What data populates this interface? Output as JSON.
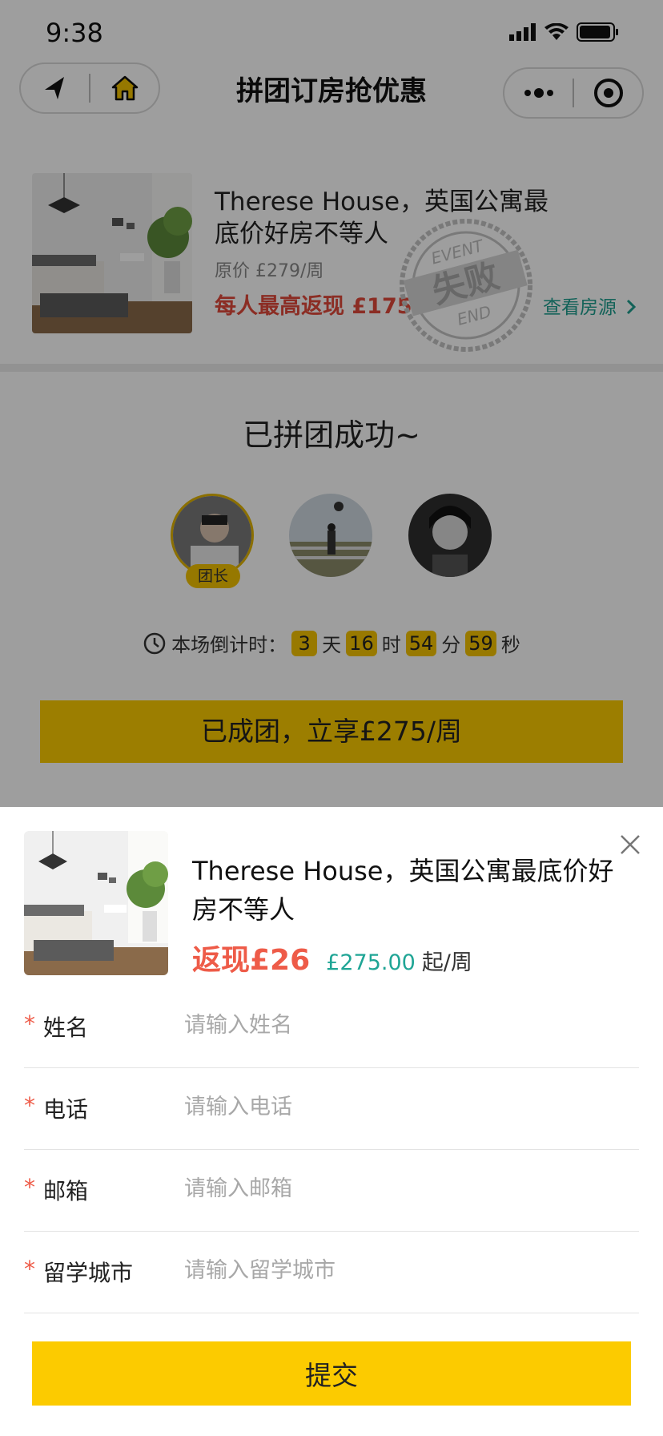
{
  "status_bar": {
    "time": "9:38"
  },
  "nav": {
    "title": "拼团订房抢优惠"
  },
  "product": {
    "title": "Therese House，英国公寓最底价好房不等人",
    "original_price": "原价 £279/周",
    "max_cashback": "每人最高返现 £175",
    "view_link": "查看房源",
    "stamp": {
      "top": "EVENT",
      "main": "失败",
      "bottom": "END"
    }
  },
  "group": {
    "title": "已拼团成功~",
    "leader_badge": "团长",
    "countdown": {
      "prefix": "本场倒计时：",
      "days": "3",
      "days_unit": "天",
      "hours": "16",
      "hours_unit": "时",
      "minutes": "54",
      "minutes_unit": "分",
      "seconds": "59",
      "seconds_unit": "秒"
    },
    "button_label": "已成团，立享£275/周"
  },
  "sheet": {
    "title": "Therese House，英国公寓最底价好房不等人",
    "cashback": "返现£26",
    "price": "£275.00",
    "price_unit": "起/周",
    "fields": [
      {
        "label": "姓名",
        "placeholder": "请输入姓名",
        "required": true
      },
      {
        "label": "电话",
        "placeholder": "请输入电话",
        "required": true
      },
      {
        "label": "邮箱",
        "placeholder": "请输入邮箱",
        "required": true
      },
      {
        "label": "留学城市",
        "placeholder": "请输入留学城市",
        "required": true
      }
    ],
    "required_mark": "*",
    "submit_label": "提交"
  },
  "colors": {
    "accent_yellow": "#fccb00",
    "cashback_red": "#ee5b48",
    "price_teal": "#1fa595",
    "link_teal": "#1e9e8f"
  },
  "icons": [
    "back-arrow-icon",
    "home-icon",
    "more-dots-icon",
    "record-icon",
    "clock-icon",
    "chevron-right-icon",
    "close-icon",
    "signal-icon",
    "wifi-icon",
    "battery-icon"
  ]
}
